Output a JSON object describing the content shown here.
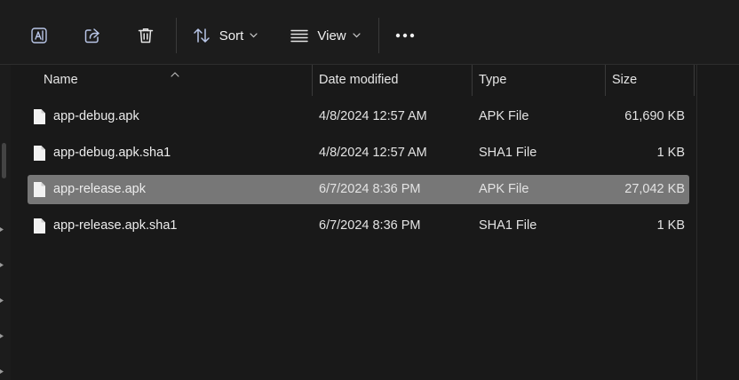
{
  "toolbar": {
    "icons": [
      "ai-rename-icon",
      "share-icon",
      "delete-icon",
      "sort-icon",
      "view-icon",
      "more-icon"
    ],
    "sort_label": "Sort",
    "view_label": "View"
  },
  "columns": {
    "name": "Name",
    "date": "Date modified",
    "type": "Type",
    "size": "Size"
  },
  "sort": {
    "column": "name",
    "direction": "ascending"
  },
  "files": [
    {
      "name": "app-debug.apk",
      "date": "4/8/2024 12:57 AM",
      "type": "APK File",
      "size": "61,690 KB",
      "selected": false
    },
    {
      "name": "app-debug.apk.sha1",
      "date": "4/8/2024 12:57 AM",
      "type": "SHA1 File",
      "size": "1 KB",
      "selected": false
    },
    {
      "name": "app-release.apk",
      "date": "6/7/2024 8:36 PM",
      "type": "APK File",
      "size": "27,042 KB",
      "selected": true
    },
    {
      "name": "app-release.apk.sha1",
      "date": "6/7/2024 8:36 PM",
      "type": "SHA1 File",
      "size": "1 KB",
      "selected": false
    }
  ],
  "colors": {
    "background": "#191919",
    "toolbar": "#1c1c1c",
    "selected_row": "#777777",
    "text": "#e6e6e6"
  }
}
